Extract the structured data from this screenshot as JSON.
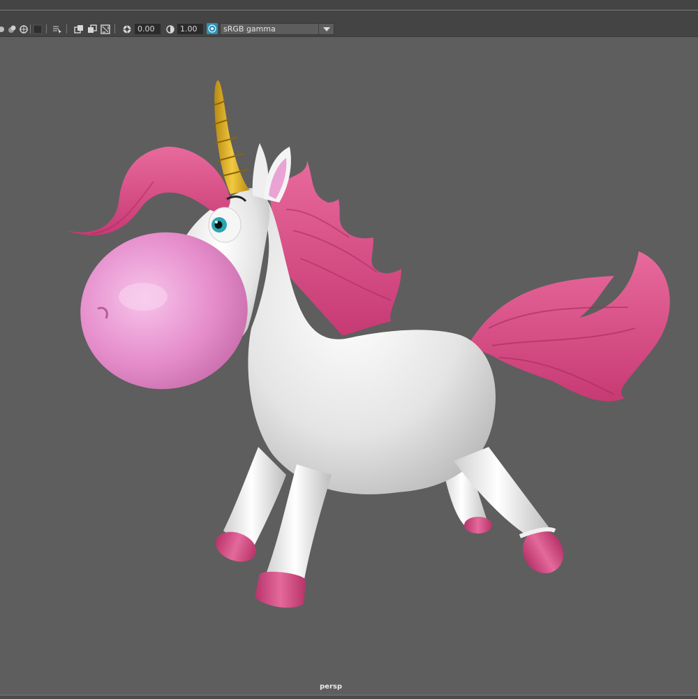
{
  "toolbar": {
    "exposure_value": "0.00",
    "gamma_value": "1.00",
    "color_space_value": "sRGB gamma",
    "icons": [
      "isolate-select-icon",
      "xray-icon",
      "wireframe-icon",
      "shaded-icon",
      "grid-icon",
      "select-camera-icon",
      "resolution-gate-icon",
      "gate-mask-icon",
      "field-chart-icon",
      "exposure-icon",
      "gamma-icon",
      "color-management-icon"
    ]
  },
  "viewport": {
    "camera_label": "persp",
    "subject": "unicorn-model",
    "colors": {
      "background": "#5e5e5e",
      "body": "#ececec",
      "mane": "#d84a86",
      "muzzle": "#e58ccb",
      "horn": "#e2b22a",
      "eye": "#2aa6b2"
    }
  }
}
